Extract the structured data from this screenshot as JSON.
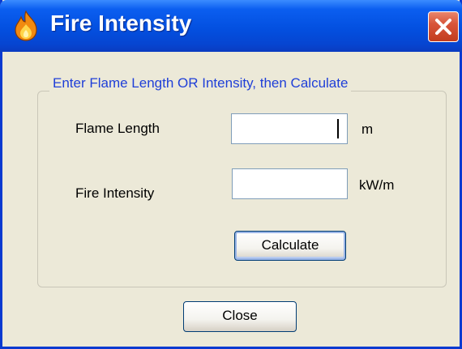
{
  "window": {
    "title": "Fire Intensity",
    "icon": "flame-icon",
    "close_icon": "close-icon"
  },
  "group": {
    "legend": "Enter Flame Length OR Intensity, then Calculate"
  },
  "fields": {
    "flame_length": {
      "label": "Flame Length",
      "value": "",
      "unit": "m"
    },
    "fire_intensity": {
      "label": "Fire Intensity",
      "value": "",
      "unit": "kW/m"
    }
  },
  "buttons": {
    "calculate": "Calculate",
    "close": "Close"
  },
  "colors": {
    "titlebar": "#0350e0",
    "close_button": "#d8553a",
    "legend_text": "#1f3fd8",
    "dialog_bg": "#ece9d8"
  }
}
